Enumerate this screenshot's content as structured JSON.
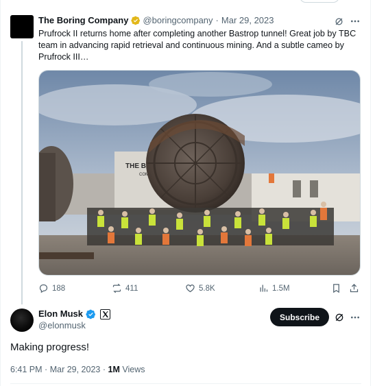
{
  "quoted_post": {
    "author_name": "The Boring Company",
    "handle": "@boringcompany",
    "separator": "·",
    "date": "Mar 29, 2023",
    "text": "Prufrock II returns home after completing another Bastrop tunnel!  Great job by TBC team in advancing rapid retrieval and continuous mining.  And a subtle cameo by Prufrock III…",
    "media_sign_line1": "THE BORING",
    "media_sign_line2": "COMPANY",
    "actions": {
      "replies": "188",
      "reposts": "411",
      "likes": "5.8K",
      "views": "1.5M"
    }
  },
  "main_post": {
    "author_name": "Elon Musk",
    "handle": "@elonmusk",
    "subscribe_label": "Subscribe",
    "text": "Making progress!",
    "time": "6:41 PM",
    "separator": "·",
    "date": "Mar 29, 2023",
    "views_count": "1M",
    "views_label": "Views"
  },
  "colors": {
    "verified_gold": "#e2b719",
    "verified_blue": "#1d9bf0",
    "muted": "#536471",
    "text": "#0f1419"
  }
}
